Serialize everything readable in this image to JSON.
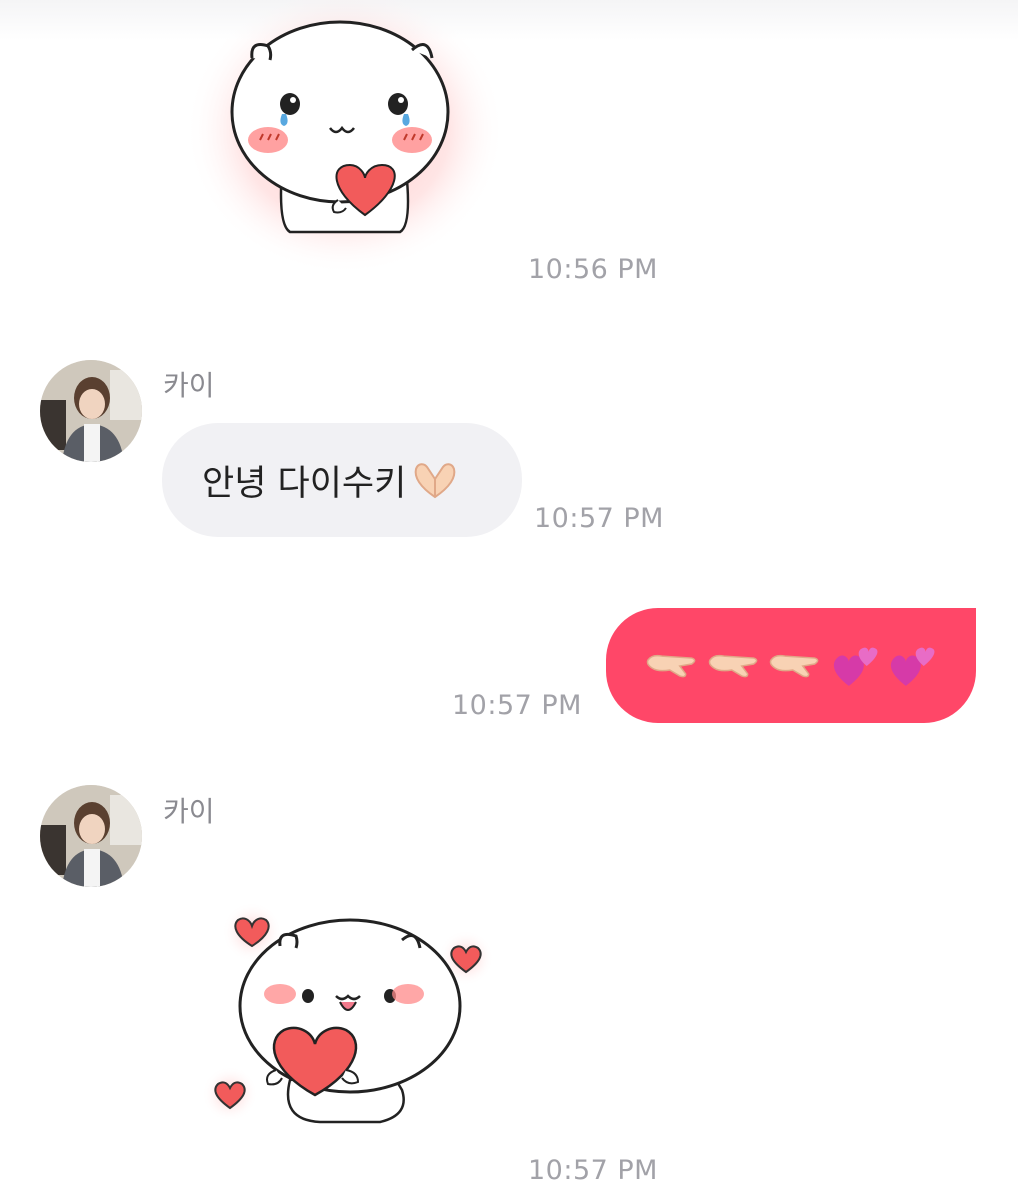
{
  "messages": [
    {
      "type": "sticker",
      "sticker_name": "crying-bear-holding-heart",
      "time": "10:56 PM"
    },
    {
      "type": "incoming-text",
      "sender": "카이",
      "text": "안녕 다이수키",
      "emoji": "heart-hands-emoji",
      "time": "10:57 PM"
    },
    {
      "type": "outgoing-emoji",
      "emojis": [
        "palm-down-hand-emoji",
        "palm-down-hand-emoji",
        "palm-down-hand-emoji",
        "two-hearts-emoji",
        "two-hearts-emoji"
      ],
      "time": "10:57 PM",
      "color": "#ff4768"
    },
    {
      "type": "incoming-sticker",
      "sender": "카이",
      "sticker_name": "happy-bear-hugging-heart",
      "time": "10:57 PM"
    }
  ],
  "colors": {
    "outgoing_bubble": "#ff4768",
    "incoming_bubble": "#f1f1f4",
    "timestamp": "#a2a2a8",
    "heart": "#f25b5b"
  }
}
